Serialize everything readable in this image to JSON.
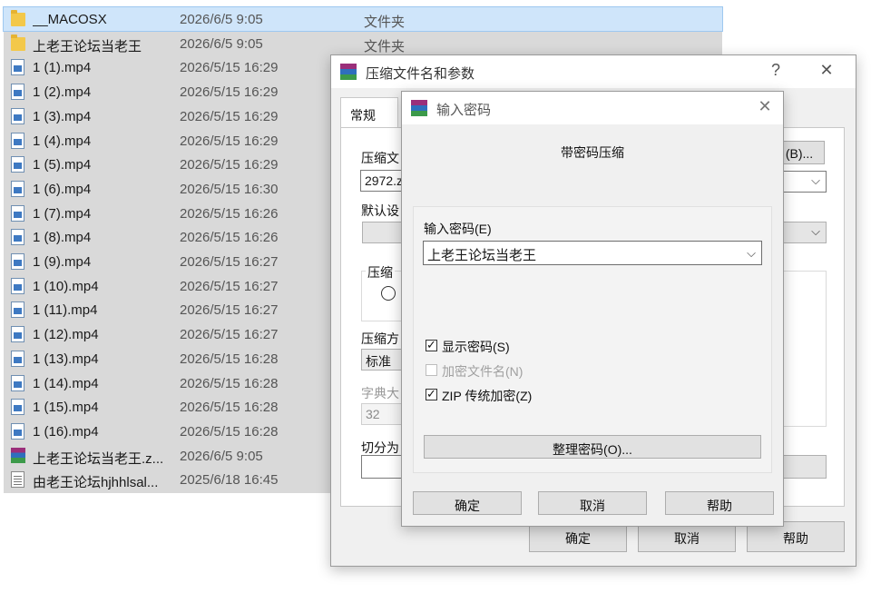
{
  "files": [
    {
      "name": "__MACOSX",
      "date": "2026/6/5 9:05",
      "type": "文件夹",
      "icon": "folder-icon"
    },
    {
      "name": "上老王论坛当老王",
      "date": "2026/6/5 9:05",
      "type": "文件夹",
      "icon": "folder-icon"
    },
    {
      "name": "1 (1).mp4",
      "date": "2026/5/15 16:29",
      "type": "",
      "icon": "video-file-icon"
    },
    {
      "name": "1 (2).mp4",
      "date": "2026/5/15 16:29",
      "type": "",
      "icon": "video-file-icon"
    },
    {
      "name": "1 (3).mp4",
      "date": "2026/5/15 16:29",
      "type": "",
      "icon": "video-file-icon"
    },
    {
      "name": "1 (4).mp4",
      "date": "2026/5/15 16:29",
      "type": "",
      "icon": "video-file-icon"
    },
    {
      "name": "1 (5).mp4",
      "date": "2026/5/15 16:29",
      "type": "",
      "icon": "video-file-icon"
    },
    {
      "name": "1 (6).mp4",
      "date": "2026/5/15 16:30",
      "type": "",
      "icon": "video-file-icon"
    },
    {
      "name": "1 (7).mp4",
      "date": "2026/5/15 16:26",
      "type": "",
      "icon": "video-file-icon"
    },
    {
      "name": "1 (8).mp4",
      "date": "2026/5/15 16:26",
      "type": "",
      "icon": "video-file-icon"
    },
    {
      "name": "1 (9).mp4",
      "date": "2026/5/15 16:27",
      "type": "",
      "icon": "video-file-icon"
    },
    {
      "name": "1 (10).mp4",
      "date": "2026/5/15 16:27",
      "type": "",
      "icon": "video-file-icon"
    },
    {
      "name": "1 (11).mp4",
      "date": "2026/5/15 16:27",
      "type": "",
      "icon": "video-file-icon"
    },
    {
      "name": "1 (12).mp4",
      "date": "2026/5/15 16:27",
      "type": "",
      "icon": "video-file-icon"
    },
    {
      "name": "1 (13).mp4",
      "date": "2026/5/15 16:28",
      "type": "",
      "icon": "video-file-icon"
    },
    {
      "name": "1 (14).mp4",
      "date": "2026/5/15 16:28",
      "type": "",
      "icon": "video-file-icon"
    },
    {
      "name": "1 (15).mp4",
      "date": "2026/5/15 16:28",
      "type": "",
      "icon": "video-file-icon"
    },
    {
      "name": "1 (16).mp4",
      "date": "2026/5/15 16:28",
      "type": "",
      "icon": "video-file-icon"
    },
    {
      "name": "上老王论坛当老王.z...",
      "date": "2026/6/5 9:05",
      "type": "",
      "icon": "rar-archive-icon"
    },
    {
      "name": "由老王论坛hjhhlsal...",
      "date": "2025/6/18 16:45",
      "type": "",
      "icon": "text-file-icon"
    }
  ],
  "archive_dialog": {
    "title": "压缩文件名和参数",
    "help_glyph": "?",
    "close_glyph": "✕",
    "tab_general": "常规",
    "archive_name_label": "压缩文",
    "archive_name_value": "2972.z",
    "browse_button": "(B)...",
    "default_profile_label": "默认设",
    "archive_format_label": "压缩",
    "compression_method_label": "压缩方",
    "compression_method_value": "标准",
    "dictionary_label": "字典大",
    "dictionary_value": "32",
    "split_label": "切分为",
    "ok": "确定",
    "cancel": "取消",
    "help": "帮助"
  },
  "password_dialog": {
    "title": "输入密码",
    "close_glyph": "✕",
    "heading": "带密码压缩",
    "password_label": "输入密码(E)",
    "password_value": "上老王论坛当老王",
    "show_password": {
      "label": "显示密码(S)",
      "checked": true,
      "enabled": true
    },
    "encrypt_names": {
      "label": "加密文件名(N)",
      "checked": false,
      "enabled": false
    },
    "zip_legacy": {
      "label": "ZIP 传统加密(Z)",
      "checked": true,
      "enabled": true
    },
    "organize_button": "整理密码(O)...",
    "ok": "确定",
    "cancel": "取消",
    "help": "帮助"
  },
  "colors": {
    "selection": "#cfe5fa",
    "list_background": "#d9d9d9",
    "dialog_face": "#f0f0f0"
  }
}
